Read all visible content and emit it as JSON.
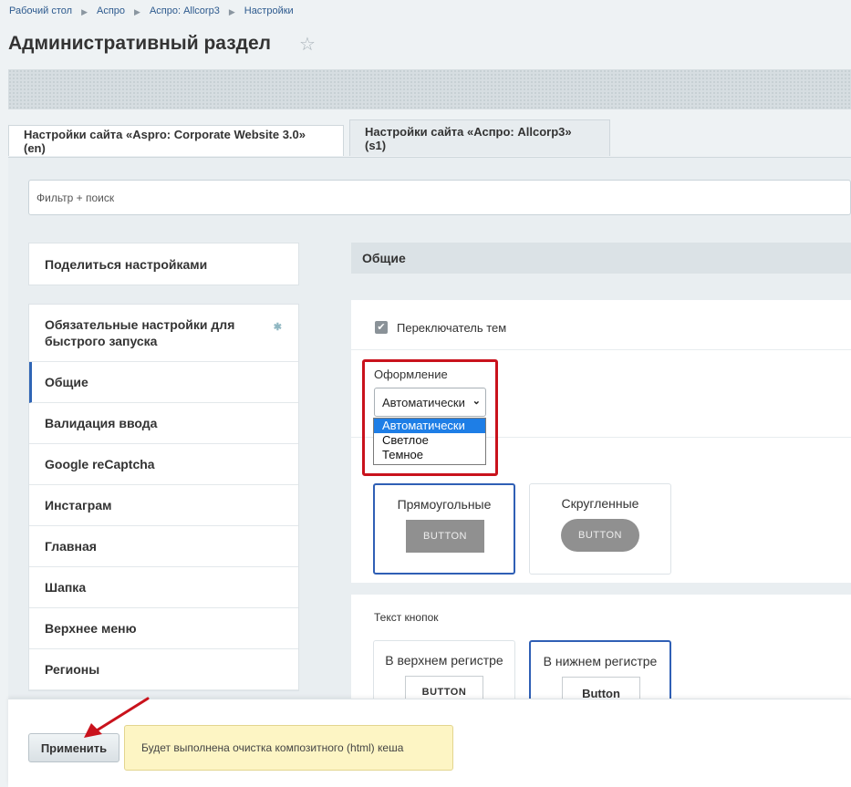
{
  "breadcrumb": [
    "Рабочий стол",
    "Аспро",
    "Аспро: Allcorp3",
    "Настройки"
  ],
  "page_title": "Административный раздел",
  "tabs": [
    {
      "label": "Настройки сайта «Aspro: Corporate Website 3.0» (en)"
    },
    {
      "label": "Настройки сайта «Аспро: Allcorp3» (s1)"
    }
  ],
  "filter": {
    "placeholder": "Фильтр + поиск"
  },
  "share_settings": "Поделиться настройками",
  "sidebar": {
    "items": [
      {
        "label": "Обязательные настройки для быстрого запуска"
      },
      {
        "label": "Общие"
      },
      {
        "label": "Валидация ввода"
      },
      {
        "label": "Google reCaptcha"
      },
      {
        "label": "Инстаграм"
      },
      {
        "label": "Главная"
      },
      {
        "label": "Шапка"
      },
      {
        "label": "Верхнее меню"
      },
      {
        "label": "Регионы"
      }
    ]
  },
  "section": {
    "title": "Общие"
  },
  "theme_switcher": {
    "label": "Переключатель тем",
    "checked": true
  },
  "design": {
    "label": "Оформление",
    "selected": "Автоматически",
    "options": [
      "Автоматически",
      "Светлое",
      "Темное"
    ]
  },
  "button_shape": {
    "options": [
      {
        "title": "Прямоугольные",
        "sample": "BUTTON"
      },
      {
        "title": "Скругленные",
        "sample": "BUTTON"
      }
    ]
  },
  "button_text": {
    "label": "Текст кнопок",
    "options": [
      {
        "title": "В верхнем регистре",
        "sample": "BUTTON"
      },
      {
        "title": "В нижнем регистре",
        "sample": "Button"
      }
    ]
  },
  "footer": {
    "apply_label": "Применить",
    "notice": "Будет выполнена очистка композитного (html) кеша"
  },
  "colors": {
    "accent": "#2f5fb5",
    "highlight": "#c9121c",
    "notice_bg": "#fdf5c4"
  }
}
